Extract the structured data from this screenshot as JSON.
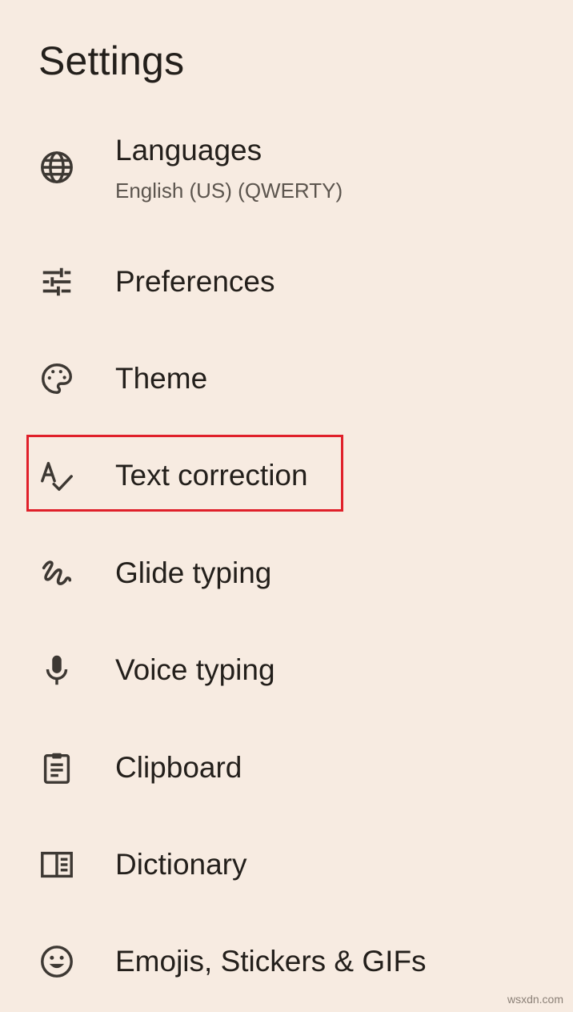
{
  "header": {
    "title": "Settings"
  },
  "settings": {
    "items": [
      {
        "label": "Languages",
        "sublabel": "English (US) (QWERTY)",
        "icon": "globe-icon"
      },
      {
        "label": "Preferences",
        "icon": "tune-sliders-icon"
      },
      {
        "label": "Theme",
        "icon": "palette-icon"
      },
      {
        "label": "Text correction",
        "icon": "spellcheck-icon"
      },
      {
        "label": "Glide typing",
        "icon": "gesture-icon"
      },
      {
        "label": "Voice typing",
        "icon": "microphone-icon"
      },
      {
        "label": "Clipboard",
        "icon": "clipboard-icon"
      },
      {
        "label": "Dictionary",
        "icon": "book-icon"
      },
      {
        "label": "Emojis, Stickers & GIFs",
        "icon": "emoji-smile-icon"
      }
    ]
  },
  "highlight": {
    "target": "Text correction",
    "color": "#e0202a"
  },
  "watermark": "wsxdn.com",
  "colors": {
    "background": "#f7ebe1",
    "text": "#231f1b",
    "secondary_text": "#5c554e",
    "icon": "#3d3833"
  }
}
